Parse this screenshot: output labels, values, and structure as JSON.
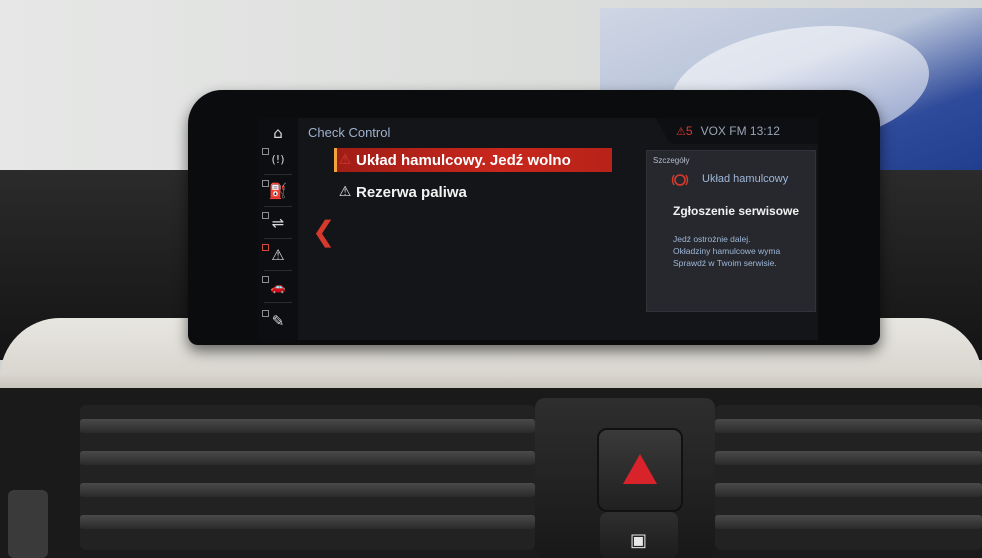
{
  "sidebar": {
    "items": [
      {
        "icon": "home-icon",
        "glyph": "⌂"
      },
      {
        "icon": "tire-pressure-icon",
        "glyph": "(!)"
      },
      {
        "icon": "oil-can-icon",
        "glyph": "⛽"
      },
      {
        "icon": "road-assist-icon",
        "glyph": "⇌"
      },
      {
        "icon": "warning-triangle-icon",
        "glyph": "⚠"
      },
      {
        "icon": "car-icon",
        "glyph": "🚗"
      },
      {
        "icon": "service-wrench-icon",
        "glyph": "✎"
      }
    ]
  },
  "main": {
    "title": "Check Control",
    "back_glyph": "❮",
    "messages": [
      {
        "label": "Układ hamulcowy. Jedź wolno",
        "selected": true
      },
      {
        "label": "Rezerwa paliwa",
        "selected": false
      }
    ],
    "warning_glyph": "⚠"
  },
  "status": {
    "warning_glyph": "⚠",
    "warning_count": "5",
    "radio": "VOX FM",
    "time": "13:12"
  },
  "details": {
    "heading": "Szczegóły",
    "item_name": "Układ hamulcowy",
    "service_title": "Zgłoszenie serwisowe",
    "lines": [
      "Jedź ostrożnie dalej.",
      "Okładziny hamulcowe wyma",
      "Sprawdź w Twoim serwisie."
    ]
  },
  "colors": {
    "accent_red": "#c8271d",
    "title_blue": "#9fb1cc",
    "detail_blue": "#9fb7d8"
  }
}
